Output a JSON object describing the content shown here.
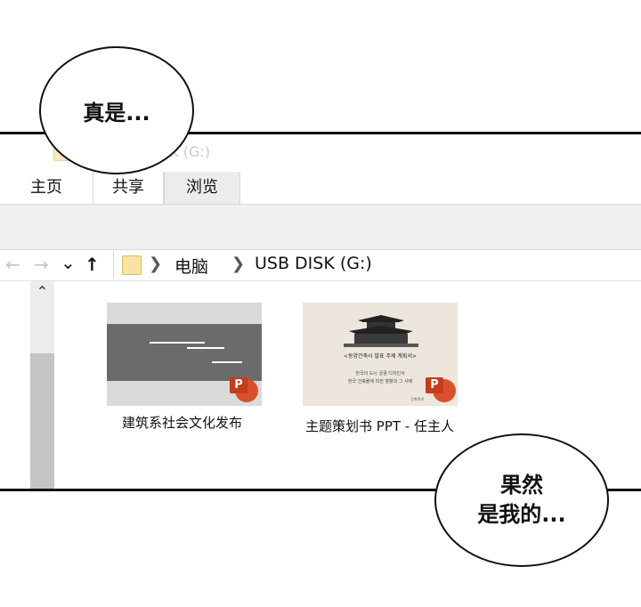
{
  "window": {
    "title": "USB DISK (G:)"
  },
  "tabs": [
    {
      "label": "主页"
    },
    {
      "label": "共享"
    },
    {
      "label": "浏览"
    }
  ],
  "address": {
    "items": [
      "电脑",
      "USB DISK (G:)"
    ]
  },
  "nav": {
    "back": "←",
    "forward": "→",
    "recent": "⌄",
    "up": "↑",
    "scroll_up": "⌃"
  },
  "files": [
    {
      "name": "建筑系社会文化发布",
      "badge": "P"
    },
    {
      "name": "主题策划书 PPT - 任主人",
      "badge": "P",
      "preview": {
        "title": "<동양건축사 발표 주제 계획서>",
        "lines": [
          "한국의 도시 궁궐 디자인서",
          "한국 건축물에 미친 영향과 그 사례"
        ],
        "footer": "건축학과"
      }
    }
  ],
  "speech": {
    "bubble1": "真是...",
    "bubble2_line1": "果然",
    "bubble2_line2": "是我的..."
  },
  "colors": {
    "ppt_accent": "#d9502b",
    "folder": "#f8e3a0"
  }
}
